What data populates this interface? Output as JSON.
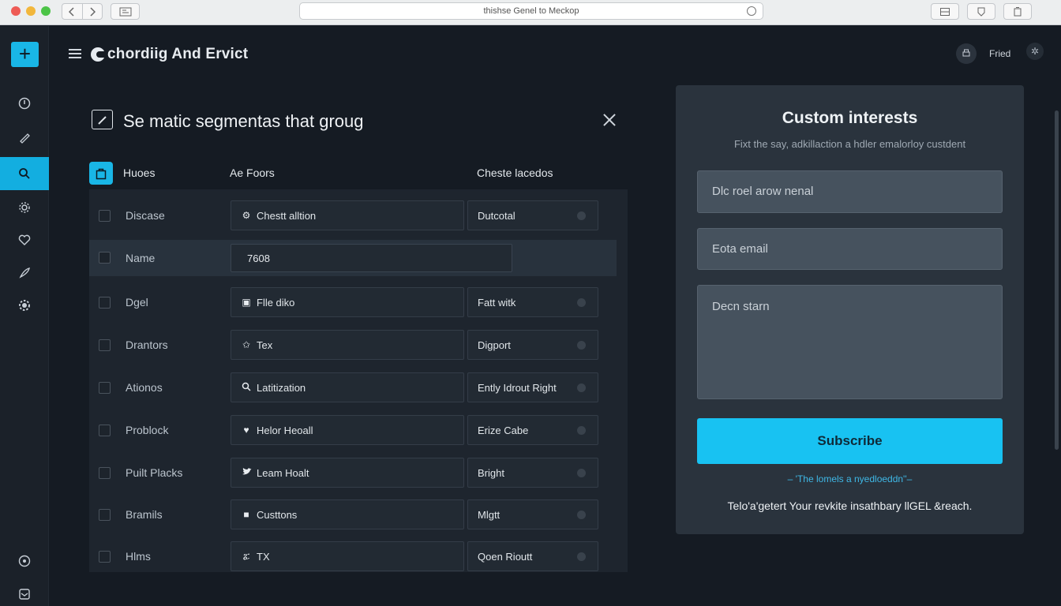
{
  "browser": {
    "url": "thishse Genel to Meckop"
  },
  "header": {
    "app_title": "chordiig And Ervict",
    "user_label": "Fried"
  },
  "dialog": {
    "title": "Se matic segmentas that groug",
    "columns": [
      "Huoes",
      "Ae Foors",
      "Cheste lacedos"
    ],
    "rows": [
      {
        "label": "Discase",
        "field_icon": "settings-icon",
        "field": "Chestt alltion",
        "option": "Dutcotal"
      },
      {
        "label": "Name",
        "field": "7608",
        "highlight": true
      },
      {
        "label": "Dgel",
        "field_icon": "file-icon",
        "field": "Flle diko",
        "option": "Fatt witk"
      },
      {
        "label": "Drantors",
        "field_icon": "star-icon",
        "field": "Tex",
        "option": "Digport"
      },
      {
        "label": "Ationos",
        "field_icon": "search-icon",
        "field": "Latitization",
        "option": "Ently Idrout Right"
      },
      {
        "label": "Problock",
        "field_icon": "heart-icon",
        "field": "Helor Heoall",
        "option": "Erize Cabe"
      },
      {
        "label": "Puilt Placks",
        "field_icon": "bird-icon",
        "field": "Leam Hoalt",
        "option": "Bright"
      },
      {
        "label": "Bramils",
        "field_icon": "square-icon",
        "field": "Custtons",
        "option": "Mlgtt"
      },
      {
        "label": "Hlms",
        "field_icon": "translate-icon",
        "field": "TX",
        "option": "Qoen Rioutt"
      }
    ]
  },
  "card": {
    "title": "Custom interests",
    "subtitle": "Fixt the say, adkillaction a hdler emalorloy custdent",
    "name_placeholder": "Dlc roel arow nenal",
    "email_placeholder": "Eota email",
    "message_placeholder": "Decn starn",
    "subscribe_label": "Subscribe",
    "link_text": "– 'The lomels a nyedloeddn''–",
    "note": "Telo'a'getert Your revkite insathbary llGEL &reach."
  },
  "colors": {
    "accent": "#19b6e6",
    "background": "#151b23",
    "card": "#2a333d"
  }
}
